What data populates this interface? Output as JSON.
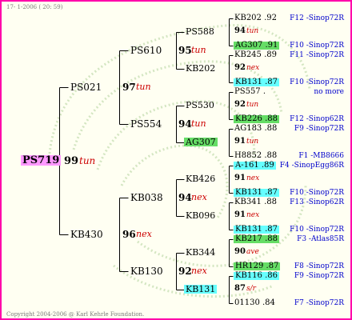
{
  "header": {
    "text": "17- 1-2006 ( 20: 59)"
  },
  "footer": {
    "text": "Copyright 2004-2006 @ Karl Kehrle Foundation."
  },
  "colors": {
    "border": "#ff00aa",
    "pink": "#ff99ff",
    "cyan": "#66ffff",
    "green": "#66dd66",
    "right_text": "#0000cc",
    "colour_text": "#cc0000"
  },
  "root": {
    "name": "PS719",
    "num": "99",
    "colour": "tun"
  },
  "gen1": [
    {
      "name": "PS021",
      "num": "97",
      "colour": "tun"
    },
    {
      "name": "KB430",
      "num": "96",
      "colour": "nex"
    }
  ],
  "gen2": [
    {
      "name": "PS610",
      "num": "95",
      "colour": "tun"
    },
    {
      "name": "PS554",
      "num": "94",
      "colour": "tun"
    },
    {
      "name": "KB038",
      "num": "94",
      "colour": "nex"
    },
    {
      "name": "KB130",
      "num": "92",
      "colour": "nex"
    }
  ],
  "gen3": [
    {
      "name": "PS588",
      "num": "94",
      "colour": "tun"
    },
    {
      "name": "KB202",
      "num": "92",
      "colour": "nex"
    },
    {
      "name": "PS530",
      "num": "92",
      "colour": "tun"
    },
    {
      "name": "AG307",
      "num": "91",
      "colour": "tun"
    },
    {
      "name": "KB426",
      "num": "91",
      "colour": "nex"
    },
    {
      "name": "KB096",
      "num": "91",
      "colour": "nex"
    },
    {
      "name": "KB344",
      "num": "90",
      "colour": "ave"
    },
    {
      "name": "KB131",
      "num": "87",
      "colour": "s/r"
    }
  ],
  "gen4": [
    {
      "name": "KB202 .92",
      "origin": "F12 -Sinop72R"
    },
    {
      "name": "AG307 .91",
      "origin": "F10 -Sinop72R"
    },
    {
      "name": "KB245 .89",
      "origin": "F11 -Sinop72R"
    },
    {
      "name": "KB131 .87",
      "origin": "F10 -Sinop72R"
    },
    {
      "name": "PS557 .",
      "origin": "no more"
    },
    {
      "name": "KB226 .88",
      "origin": "F12 -Sinop62R"
    },
    {
      "name": "AG183 .88",
      "origin": "F9 -Sinop72R"
    },
    {
      "name": "H8852 .88",
      "origin": "F1 -MB8666"
    },
    {
      "name": "A-161 .89",
      "origin": "F4 -SinopEgg86R"
    },
    {
      "name": "KB131 .87",
      "origin": "F10 -Sinop72R"
    },
    {
      "name": "KB341 .88",
      "origin": "F13 -Sinop62R"
    },
    {
      "name": "KB131 .87",
      "origin": "F10 -Sinop72R"
    },
    {
      "name": "KB217 .88",
      "origin": "F3 -Atlas85R"
    },
    {
      "name": "HR129 .87",
      "origin": "F8 -Sinop72R"
    },
    {
      "name": "KB116 .86",
      "origin": "F9 -Sinop72R"
    },
    {
      "name": "01130 .84",
      "origin": "F7 -Sinop72R"
    }
  ]
}
